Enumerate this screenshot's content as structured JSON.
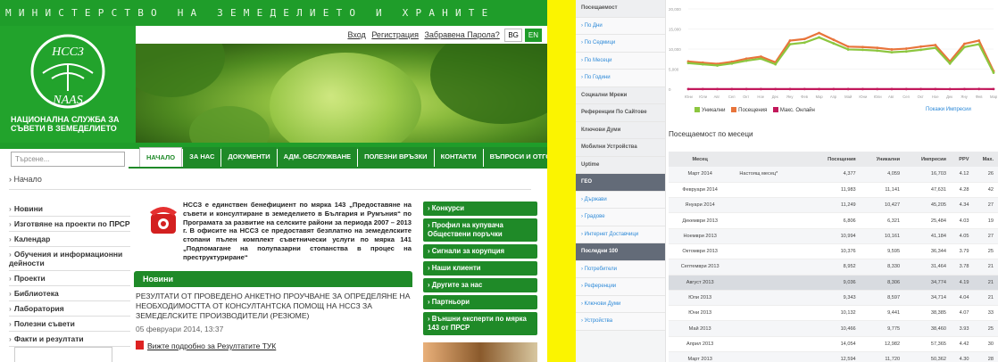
{
  "site": {
    "top_title": "МИНИСТЕРСТВО НА ЗЕМЕДЕЛИЕТО И ХРАНИТЕ",
    "logo_top": "НССЗ",
    "logo_bottom": "NAAS",
    "logo_name": "НАЦИОНАЛНА СЛУЖБА ЗА СЪВЕТИ В ЗЕМЕДЕЛИЕТО",
    "links": [
      "Вход",
      "Регистрация",
      "Забравена Парола?"
    ],
    "lang_bg": "BG",
    "lang_en": "EN",
    "search_placeholder": "Търсене...",
    "nav": [
      "НАЧАЛО",
      "ЗА НАС",
      "ДОКУМЕНТИ",
      "АДМ. ОБСЛУЖВАНЕ",
      "ПОЛЕЗНИ ВРЪЗКИ",
      "КОНТАКТИ",
      "ВЪПРОСИ И ОТГОВОРИ"
    ],
    "breadcrumb": "› Начало",
    "menu": [
      "Новини",
      "Изготвяне на проекти по ПРСР",
      "Календар",
      "Обучения и информационни дейности",
      "Проекти",
      "Библиотека",
      "Лаборатория",
      "Полезни съвети",
      "Факти и резултати"
    ],
    "intro": "НССЗ е единствен бенефициент по мярка 143 „Предоставяне на съвети и консултиране в земеделието в България и Румъния“ по Програмата за развитие на селските райони за периода 2007 – 2013 г. В офисите на НССЗ се предоставят безплатно на земеделските стопани пълен комплект съветнически услуги по мярка 141 „Подпомагане на полупазарни стопанства в процес на преструктуриране“",
    "news_header": "Новини",
    "news_title": "РЕЗУЛТАТИ ОТ ПРОВЕДЕНО АНКЕТНО ПРОУЧВАНЕ ЗА ОПРЕДЕЛЯНЕ НА НЕОБХОДИМОСТТА ОТ КОНСУЛТАНТСКА ПОМОЩ НА НССЗ ЗА ЗЕМЕДЕЛСКИТЕ ПРОИЗВОДИТЕЛИ (РЕЗЮМЕ)",
    "news_date": "05 февруари 2014, 13:37",
    "news_link": "Вижте подробно за Резултатите ТУК",
    "right_buttons": [
      "› Конкурси",
      "› Профил на купувача Обществени поръчки",
      "› Сигнали за корупция",
      "› Наши клиенти",
      "› Другите за нас",
      "› Партньори",
      "› Външни експерти по мярка 143 от ПРСР"
    ]
  },
  "stats": {
    "sidebar": [
      {
        "label": "Посещаемост",
        "kind": "head"
      },
      {
        "label": "› По Дни",
        "kind": "sub"
      },
      {
        "label": "› По Седмици",
        "kind": "sub"
      },
      {
        "label": "› По Месеци",
        "kind": "sub"
      },
      {
        "label": "› По Години",
        "kind": "sub"
      },
      {
        "label": "Социални Мрежи",
        "kind": "head"
      },
      {
        "label": "Референции По Сайтове",
        "kind": "head"
      },
      {
        "label": "Ключови Думи",
        "kind": "head"
      },
      {
        "label": "Мобилни Устройства",
        "kind": "head"
      },
      {
        "label": "Uptime",
        "kind": "head"
      },
      {
        "label": "ГЕО",
        "kind": "dark"
      },
      {
        "label": "› Държави",
        "kind": "sub"
      },
      {
        "label": "› Градове",
        "kind": "sub"
      },
      {
        "label": "› Интернет Доставчици",
        "kind": "sub"
      },
      {
        "label": "Последни 100",
        "kind": "dark"
      },
      {
        "label": "› Потребители",
        "kind": "sub"
      },
      {
        "label": "› Референции",
        "kind": "sub"
      },
      {
        "label": "› Ключови Думи",
        "kind": "sub"
      },
      {
        "label": "› Устройства",
        "kind": "sub"
      }
    ],
    "legend": [
      "Уникални",
      "Посещения",
      "Макс. Онлайн"
    ],
    "legend_colors": [
      "#8cc63f",
      "#e8743b",
      "#c2185b"
    ],
    "show_impressions": "Покажи Импресии",
    "section_title": "Посещаемост по месеци",
    "columns": [
      "Месец",
      "",
      "Посещения",
      "Уникални",
      "Импресии",
      "PPV",
      "Max."
    ],
    "rows": [
      [
        "Март 2014",
        "Настоящ месец*",
        "4,377",
        "4,059",
        "16,703",
        "4.12",
        "26"
      ],
      [
        "Февруари 2014",
        "",
        "11,983",
        "11,141",
        "47,631",
        "4.28",
        "42"
      ],
      [
        "Януари 2014",
        "",
        "11,249",
        "10,427",
        "45,205",
        "4.34",
        "27"
      ],
      [
        "Декември 2013",
        "",
        "6,806",
        "6,321",
        "25,484",
        "4.03",
        "19"
      ],
      [
        "Ноември 2013",
        "",
        "10,994",
        "10,161",
        "41,184",
        "4.05",
        "27"
      ],
      [
        "Октомври 2013",
        "",
        "10,376",
        "9,595",
        "36,344",
        "3.79",
        "25"
      ],
      [
        "Септември 2013",
        "",
        "8,952",
        "8,330",
        "31,464",
        "3.78",
        "21"
      ],
      [
        "Август 2013",
        "",
        "9,036",
        "8,306",
        "34,774",
        "4.19",
        "21"
      ],
      [
        "Юли 2013",
        "",
        "9,343",
        "8,597",
        "34,714",
        "4.04",
        "21"
      ],
      [
        "Юни 2013",
        "",
        "10,132",
        "9,441",
        "38,385",
        "4.07",
        "33"
      ],
      [
        "Май 2013",
        "",
        "10,466",
        "9,775",
        "38,460",
        "3.93",
        "25"
      ],
      [
        "Април 2013",
        "",
        "14,054",
        "12,982",
        "57,365",
        "4.42",
        "30"
      ],
      [
        "Март 2013",
        "",
        "12,594",
        "11,720",
        "50,362",
        "4.30",
        "28"
      ]
    ],
    "chart_data": {
      "type": "line",
      "ylim": [
        0,
        20000
      ],
      "yticks": [
        "20,000",
        "15,000",
        "10,000",
        "5,000",
        "0"
      ],
      "categories": [
        "Юни",
        "Юли",
        "Авг",
        "Сеп",
        "Окт",
        "Ное",
        "Дек",
        "Яну",
        "Фев",
        "Мар",
        "Апр",
        "Май",
        "Юни",
        "Юли",
        "Авг",
        "Сеп",
        "Окт",
        "Ное",
        "Дек",
        "Яну",
        "Фев",
        "Мар"
      ],
      "series": [
        {
          "name": "Уникални",
          "color": "#8cc63f",
          "values": [
            6500,
            6200,
            5900,
            6400,
            7100,
            7600,
            6200,
            11200,
            11600,
            12900,
            11400,
            9900,
            9800,
            9600,
            9200,
            9400,
            9800,
            10300,
            6400,
            10500,
            11200,
            4100
          ]
        },
        {
          "name": "Посещения",
          "color": "#e8743b",
          "values": [
            6900,
            6600,
            6300,
            6800,
            7600,
            8100,
            6700,
            12100,
            12500,
            14000,
            12300,
            10600,
            10500,
            10300,
            9900,
            10100,
            10600,
            11000,
            6900,
            11300,
            12100,
            4500
          ]
        },
        {
          "name": "Макс. Онлайн",
          "color": "#c2185b",
          "values": [
            30,
            28,
            25,
            27,
            30,
            33,
            22,
            30,
            29,
            30,
            28,
            25,
            33,
            21,
            21,
            21,
            25,
            27,
            19,
            27,
            42,
            26
          ]
        }
      ]
    }
  }
}
